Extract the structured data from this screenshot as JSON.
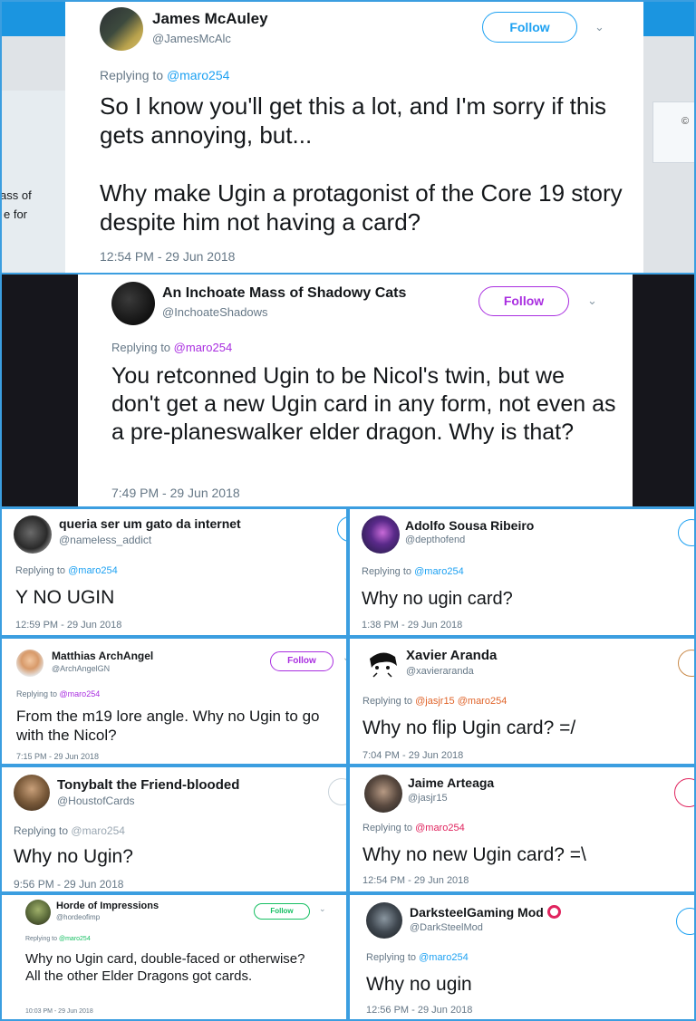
{
  "colors": {
    "link": "#1da1f2",
    "purple": "#a92ee0",
    "frame": "#3b9ee0"
  },
  "tweets": [
    {
      "name": "James McAuley",
      "handle": "@JamesMcAlc",
      "follow": "Follow",
      "replying": "Replying to",
      "reply_handles": "@maro254",
      "text": "So I know you'll get this a lot, and I'm sorry if this gets annoying, but...\n\nWhy make Ugin a protagonist of the Core 19 story despite him not having a card?",
      "time": "12:54 PM - 29 Jun 2018",
      "bg_fragments": [
        "ass of",
        "e for",
        "©"
      ]
    },
    {
      "name": "An Inchoate Mass of Shadowy Cats",
      "handle": "@InchoateShadows",
      "follow": "Follow",
      "replying": "Replying to",
      "reply_handles": "@maro254",
      "text": "You retconned Ugin to be Nicol's twin, but we don't get a new Ugin card in any form, not even as a pre-planeswalker elder dragon. Why is that?",
      "time": "7:49 PM - 29 Jun 2018"
    },
    {
      "name": "queria ser um gato da internet",
      "handle": "@nameless_addict",
      "replying": "Replying to",
      "reply_handles": "@maro254",
      "text": "Y NO UGIN",
      "time": "12:59 PM - 29 Jun 2018"
    },
    {
      "name": "Adolfo Sousa Ribeiro",
      "handle": "@depthofend",
      "replying": "Replying to",
      "reply_handles": "@maro254",
      "text": "Why no ugin card?",
      "time": "1:38 PM - 29 Jun 2018"
    },
    {
      "name": "Matthias ArchAngel",
      "handle": "@ArchAngelGN",
      "follow": "Follow",
      "replying": "Replying to",
      "reply_handles": "@maro254",
      "text": "From the m19 lore angle. Why no Ugin to go with the Nicol?",
      "time": "7:15 PM - 29 Jun 2018"
    },
    {
      "name": "Xavier Aranda",
      "handle": "@xavieraranda",
      "replying": "Replying to",
      "reply_handles": "@jasjr15 @maro254",
      "text": "Why no flip Ugin card? =/",
      "time": "7:04 PM - 29 Jun 2018"
    },
    {
      "name": "Tonybalt the Friend-blooded",
      "handle": "@HoustofCards",
      "replying": "Replying to",
      "reply_handles": "@maro254",
      "text": "Why no Ugin?",
      "time": "9:56 PM - 29 Jun 2018"
    },
    {
      "name": "Jaime Arteaga",
      "handle": "@jasjr15",
      "replying": "Replying to",
      "reply_handles": "@maro254",
      "text": "Why no new Ugin card? =\\",
      "time": "12:54 PM - 29 Jun 2018"
    },
    {
      "name": "Horde of Impressions",
      "handle": "@hordeofimp",
      "follow": "Follow",
      "replying": "Replying to",
      "reply_handles": "@maro254",
      "text": "Why no Ugin card, double-faced or otherwise? All the other Elder Dragons got cards.",
      "time": "10:03 PM - 29 Jun 2018"
    },
    {
      "name": "DarksteelGaming Mod",
      "handle": "@DarkSteelMod",
      "replying": "Replying to",
      "reply_handles": "@maro254",
      "text": "Why no ugin",
      "time": "12:56 PM - 29 Jun 2018"
    }
  ]
}
